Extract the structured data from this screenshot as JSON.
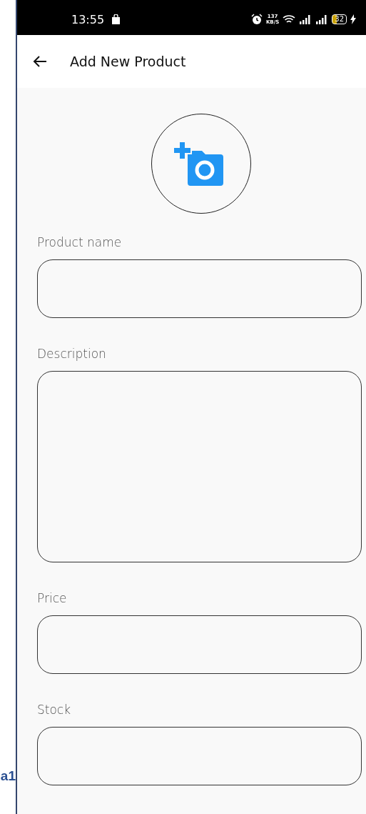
{
  "page_fragment": {
    "text": "a1"
  },
  "status_bar": {
    "time": "13:55",
    "network_speed": "137",
    "network_unit": "KB/S",
    "battery": "32"
  },
  "header": {
    "title": "Add New Product"
  },
  "fields": [
    {
      "label": "Product name",
      "kind": "single"
    },
    {
      "label": "Description",
      "kind": "multiline"
    },
    {
      "label": "Price",
      "kind": "single"
    },
    {
      "label": "Stock",
      "kind": "single"
    }
  ]
}
